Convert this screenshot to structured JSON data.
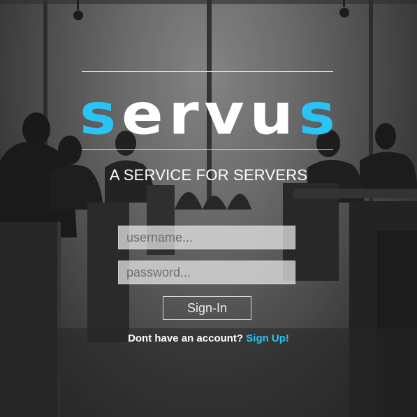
{
  "brand": {
    "letters": [
      "s",
      "e",
      "r",
      "v",
      "u",
      "s"
    ],
    "accent_color": "#29c3f5",
    "tagline": "A SERVICE FOR SERVERS"
  },
  "form": {
    "username_placeholder": "username...",
    "password_placeholder": "password...",
    "signin_label": "Sign-In"
  },
  "footer": {
    "prompt": "Dont have an account?",
    "signup_label": "Sign Up!"
  }
}
